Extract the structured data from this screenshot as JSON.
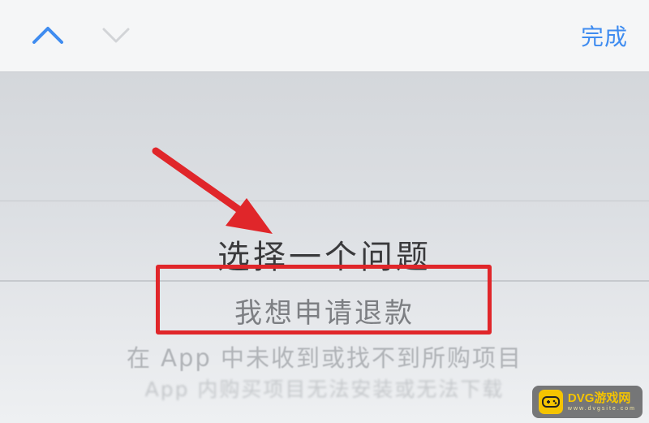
{
  "toolbar": {
    "prev_icon": "chevron-up-icon",
    "next_icon": "chevron-down-icon",
    "done_label": "完成",
    "accent_color": "#3f8cf0"
  },
  "picker": {
    "title": "选择一个问题",
    "selected": "我想申请退款",
    "options": [
      "在 App 中未收到或找不到所购项目",
      "App 内购买项目无法安装或无法下载"
    ]
  },
  "annotation": {
    "highlight_color": "#e0262a",
    "arrow_icon": "red-arrow-icon"
  },
  "watermark": {
    "name": "DVG游戏网",
    "url": "www.dvgsite.com"
  }
}
